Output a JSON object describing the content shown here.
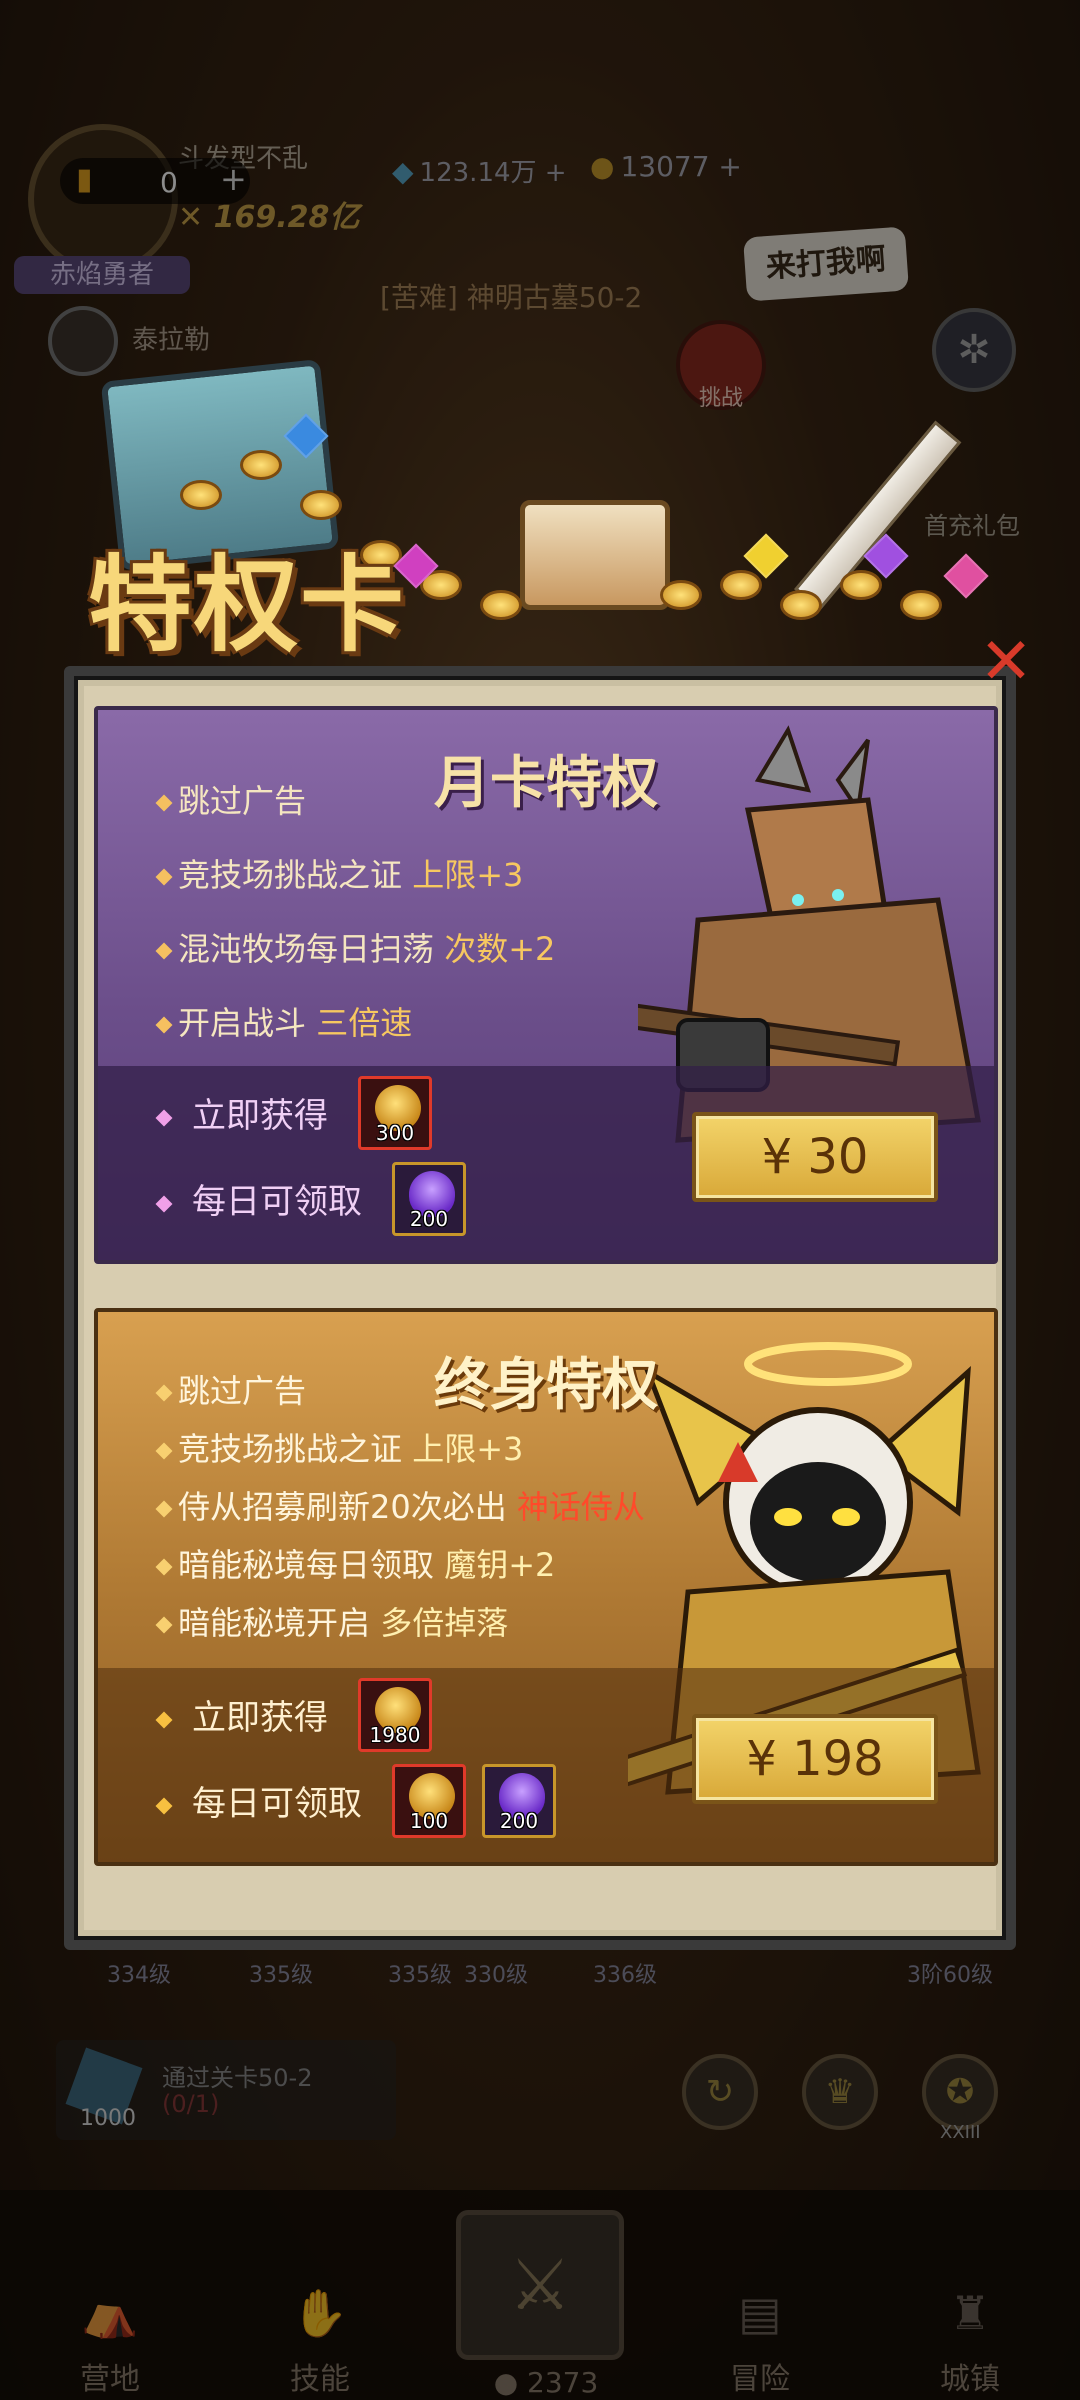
{
  "top_bar": {
    "ticket_count": "0",
    "player_name": "斗发型不乱",
    "combat_power": "169.28亿",
    "gems": "123.14万",
    "coins": "13077",
    "rank_badge": "赤焰勇者",
    "ally_name": "泰拉勒",
    "stage_title": "[苦难] 神明古墓50-2",
    "shout_bubble": "来打我啊",
    "challenge_label": "挑战",
    "first_recharge_label": "首充礼包"
  },
  "modal": {
    "title": "特权卡",
    "close_icon": "close-icon"
  },
  "monthly_card": {
    "title": "月卡特权",
    "features": [
      {
        "text": "跳过广告",
        "highlight": ""
      },
      {
        "text": "竞技场挑战之证 ",
        "highlight": "上限+3"
      },
      {
        "text": "混沌牧场每日扫荡 ",
        "highlight": "次数+2"
      },
      {
        "text": "开启战斗 ",
        "highlight": "三倍速"
      }
    ],
    "instant_label": "立即获得",
    "daily_label": "每日可领取",
    "instant_rewards": [
      {
        "icon": "gold-skull-coin-icon",
        "qty": "300"
      }
    ],
    "daily_rewards": [
      {
        "icon": "purple-flame-icon",
        "qty": "200"
      }
    ],
    "price": "¥ 30",
    "colors": {
      "panel": "#6b4e8a",
      "highlight": "#f7c860"
    }
  },
  "lifetime_card": {
    "title": "终身特权",
    "features": [
      {
        "text": "跳过广告",
        "highlight": ""
      },
      {
        "text": "竞技场挑战之证 ",
        "highlight": "上限+3"
      },
      {
        "text": "侍从招募刷新20次必出 ",
        "highlight": "神话侍从"
      },
      {
        "text": "暗能秘境每日领取 ",
        "highlight": "魔钥+2"
      },
      {
        "text": "暗能秘境开启 ",
        "highlight": "多倍掉落"
      }
    ],
    "instant_label": "立即获得",
    "daily_label": "每日可领取",
    "instant_rewards": [
      {
        "icon": "gold-skull-coin-icon",
        "qty": "1980"
      }
    ],
    "daily_rewards": [
      {
        "icon": "gold-skull-coin-icon",
        "qty": "100"
      },
      {
        "icon": "purple-flame-icon",
        "qty": "200"
      }
    ],
    "price": "¥ 198",
    "colors": {
      "panel": "#b07a34",
      "highlight_red": "#ff4a2a"
    }
  },
  "background_bottom": {
    "level_tags": [
      "334级",
      "335级",
      "335级",
      "330级",
      "336级",
      "3阶60级"
    ],
    "quest_text": "通过关卡50-2",
    "quest_progress": "(0/1)",
    "quest_reward_qty": "1000",
    "skill_level": "XXIII",
    "nav": {
      "camp": "营地",
      "skill": "技能",
      "battle_count": "2373",
      "adventure": "冒险",
      "town": "城镇"
    }
  }
}
